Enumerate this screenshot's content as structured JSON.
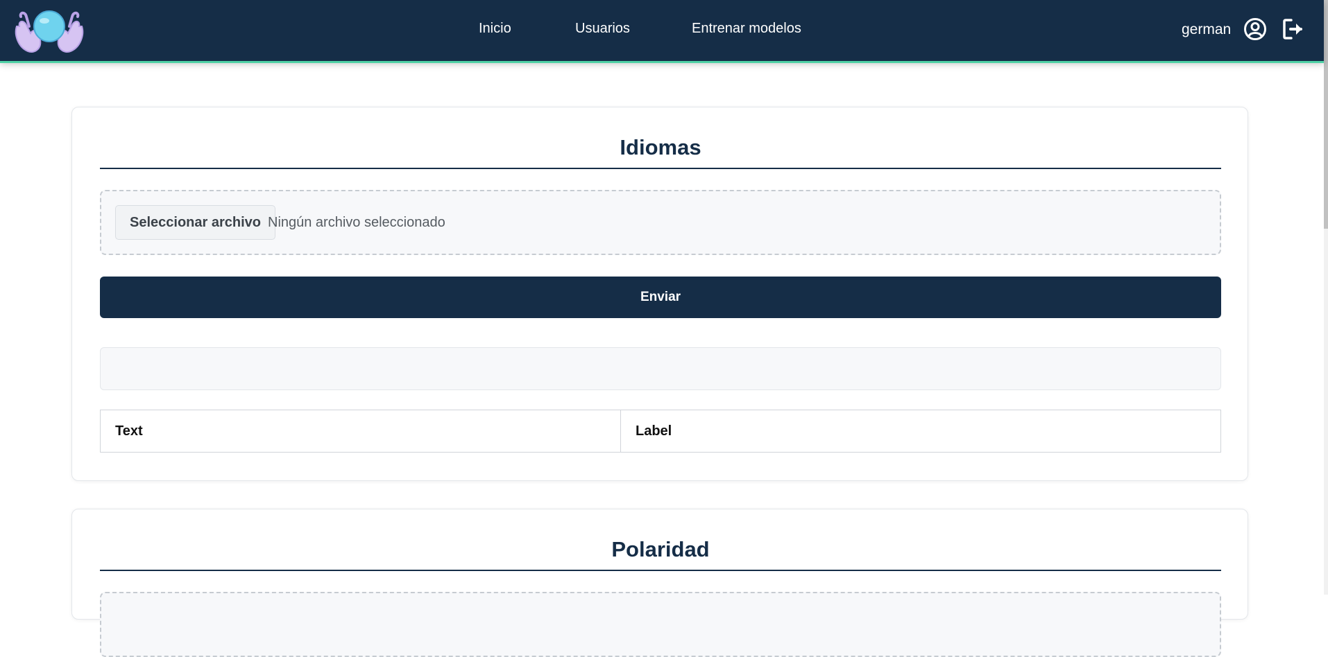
{
  "navbar": {
    "logo": "crystal-ball-hands-logo",
    "links": [
      "Inicio",
      "Usuarios",
      "Entrenar modelos"
    ],
    "username": "german",
    "icons": [
      "user-circle-icon",
      "logout-icon"
    ]
  },
  "colors": {
    "navbar_bg": "#152d47",
    "navbar_accent": "#4fd1a5",
    "primary_button": "#152d47"
  },
  "sections": [
    {
      "title": "Idiomas",
      "file_button": "Seleccionar archivo",
      "file_status": "Ningún archivo seleccionado",
      "submit_label": "Enviar",
      "table_headers": [
        "Text",
        "Label"
      ]
    },
    {
      "title": "Polaridad"
    }
  ]
}
